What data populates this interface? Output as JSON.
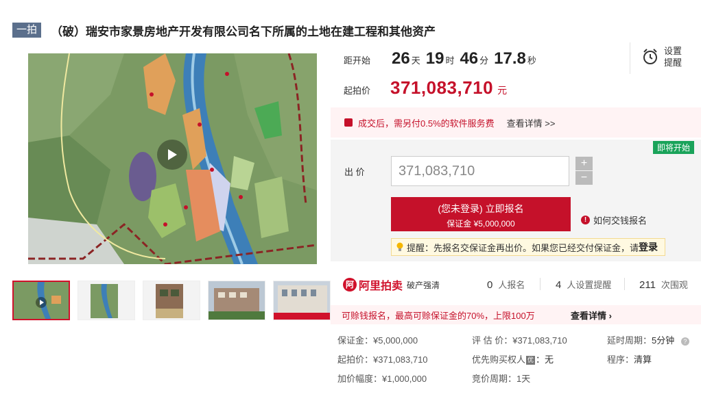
{
  "header": {
    "tag": "一拍",
    "title": "（破）瑞安市家景房地产开发有限公司名下所属的土地在建工程和其他资产"
  },
  "countdown": {
    "label": "距开始",
    "days": "26",
    "days_unit": "天",
    "hours": "19",
    "hours_unit": "时",
    "minutes": "46",
    "minutes_unit": "分",
    "seconds": "17.8",
    "seconds_unit": "秒"
  },
  "reminder": {
    "line1": "设置",
    "line2": "提醒"
  },
  "start_price": {
    "label": "起拍价",
    "value": "371,083,710",
    "unit": "元"
  },
  "fee_notice": {
    "text": "成交后，需另付0.5%的软件服务费",
    "link": "查看详情 >>"
  },
  "bid": {
    "badge": "即将开始",
    "label": "出 价",
    "value": "371,083,710",
    "plus": "+",
    "minus": "−",
    "apply_line1": "(您未登录) 立即报名",
    "apply_line2": "保证金 ¥5,000,000",
    "howto": "如何交钱报名",
    "howto_icon": "!",
    "tip_text": "提醒：先报名交保证金再出价。如果您已经交付保证金，请",
    "tip_login": "登录"
  },
  "brand": {
    "logo_char": "阿",
    "name": "阿里拍卖",
    "sub": "破产强清"
  },
  "stats": [
    {
      "num": "0",
      "label": "人报名"
    },
    {
      "num": "4",
      "label": "人设置提醒"
    },
    {
      "num": "211",
      "label": "次围观"
    }
  ],
  "deposit_notice": {
    "text": "可赊钱报名，最高可赊保证金的70%，上限100万",
    "link": "查看详情 ›"
  },
  "details": {
    "deposit": "保证金：¥5,000,000",
    "appraisal": "评 估 价：¥371,083,710",
    "delay_label": "延时周期：",
    "delay_value": "5分钟",
    "start": "起拍价：¥371,083,710",
    "priority_label": "优先购买权人",
    "priority_icon": "优",
    "priority_value": "：无",
    "procedure_label": "程序：",
    "procedure_value": "清算",
    "increment": "加价幅度：¥1,000,000",
    "cycle": "竞价周期：1天"
  },
  "colors": {
    "accent": "#c5112a",
    "tag_bg": "#5b6f8c",
    "badge_green": "#1aa35a"
  }
}
